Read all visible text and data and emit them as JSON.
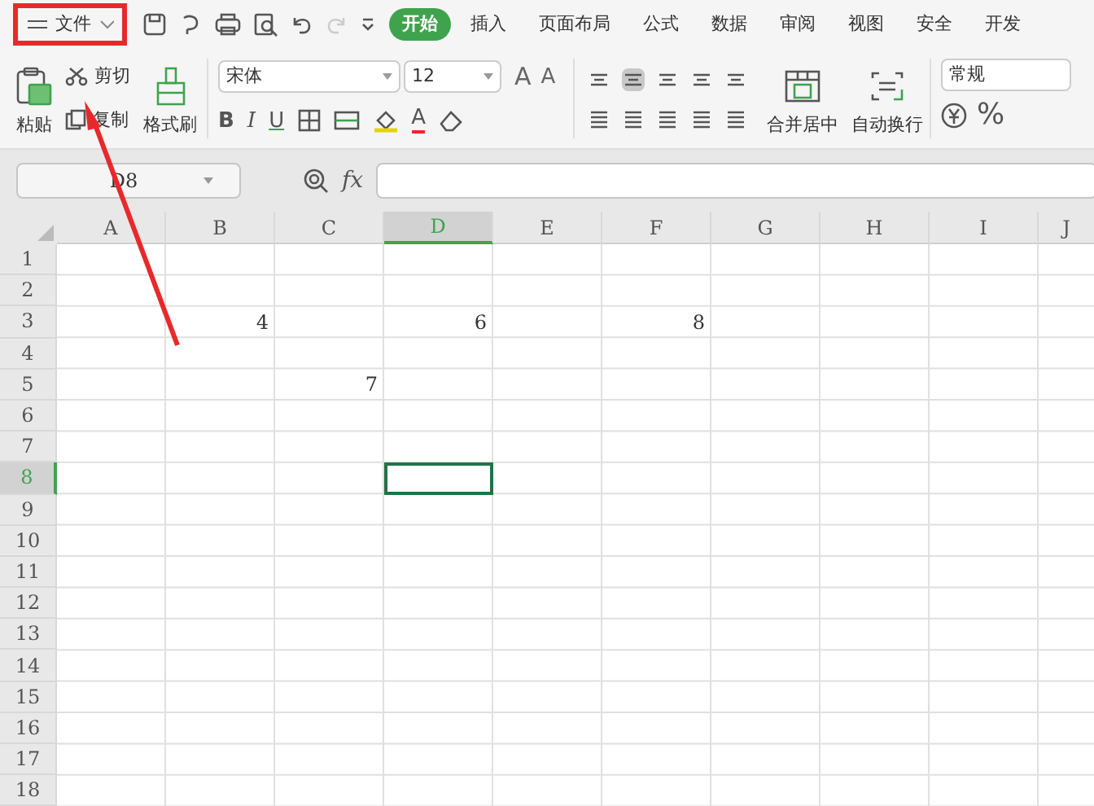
{
  "file_menu": {
    "label": "文件",
    "highlighted": true
  },
  "menu_tabs": [
    {
      "label": "开始",
      "selected": true
    },
    {
      "label": "插入",
      "selected": false
    },
    {
      "label": "页面布局",
      "selected": false
    },
    {
      "label": "公式",
      "selected": false
    },
    {
      "label": "数据",
      "selected": false
    },
    {
      "label": "审阅",
      "selected": false
    },
    {
      "label": "视图",
      "selected": false
    },
    {
      "label": "安全",
      "selected": false
    },
    {
      "label": "开发",
      "selected": false
    }
  ],
  "clipboard": {
    "paste": "粘贴",
    "cut": "剪切",
    "copy": "复制",
    "format_painter": "格式刷"
  },
  "font": {
    "name": "宋体",
    "size": "12",
    "grow": "A",
    "shrink": "A",
    "bold": "B",
    "italic": "I",
    "underline": "U",
    "font_color": "A"
  },
  "alignment": {
    "merge": "合并居中",
    "wrap": "自动换行"
  },
  "number_format": {
    "value": "常规",
    "percent": "%"
  },
  "name_box": "D8",
  "formula_label": "fx",
  "columns": [
    {
      "label": "A",
      "selected": false
    },
    {
      "label": "B",
      "selected": false
    },
    {
      "label": "C",
      "selected": false
    },
    {
      "label": "D",
      "selected": true
    },
    {
      "label": "E",
      "selected": false
    },
    {
      "label": "F",
      "selected": false
    },
    {
      "label": "G",
      "selected": false
    },
    {
      "label": "H",
      "selected": false
    },
    {
      "label": "I",
      "selected": false
    },
    {
      "label": "J",
      "selected": false
    }
  ],
  "rows": [
    {
      "label": "1",
      "selected": false,
      "cells": {}
    },
    {
      "label": "2",
      "selected": false,
      "cells": {}
    },
    {
      "label": "3",
      "selected": false,
      "cells": {
        "1": "4",
        "3": "6",
        "5": "8"
      }
    },
    {
      "label": "4",
      "selected": false,
      "cells": {}
    },
    {
      "label": "5",
      "selected": false,
      "cells": {
        "2": "7"
      }
    },
    {
      "label": "6",
      "selected": false,
      "cells": {}
    },
    {
      "label": "7",
      "selected": false,
      "cells": {}
    },
    {
      "label": "8",
      "selected": true,
      "cells": {}
    },
    {
      "label": "9",
      "selected": false,
      "cells": {}
    },
    {
      "label": "10",
      "selected": false,
      "cells": {}
    },
    {
      "label": "11",
      "selected": false,
      "cells": {}
    },
    {
      "label": "12",
      "selected": false,
      "cells": {}
    },
    {
      "label": "13",
      "selected": false,
      "cells": {}
    },
    {
      "label": "14",
      "selected": false,
      "cells": {}
    },
    {
      "label": "15",
      "selected": false,
      "cells": {}
    },
    {
      "label": "16",
      "selected": false,
      "cells": {}
    },
    {
      "label": "17",
      "selected": false,
      "cells": {}
    },
    {
      "label": "18",
      "selected": false,
      "cells": {}
    }
  ],
  "annotation_arrow": true
}
